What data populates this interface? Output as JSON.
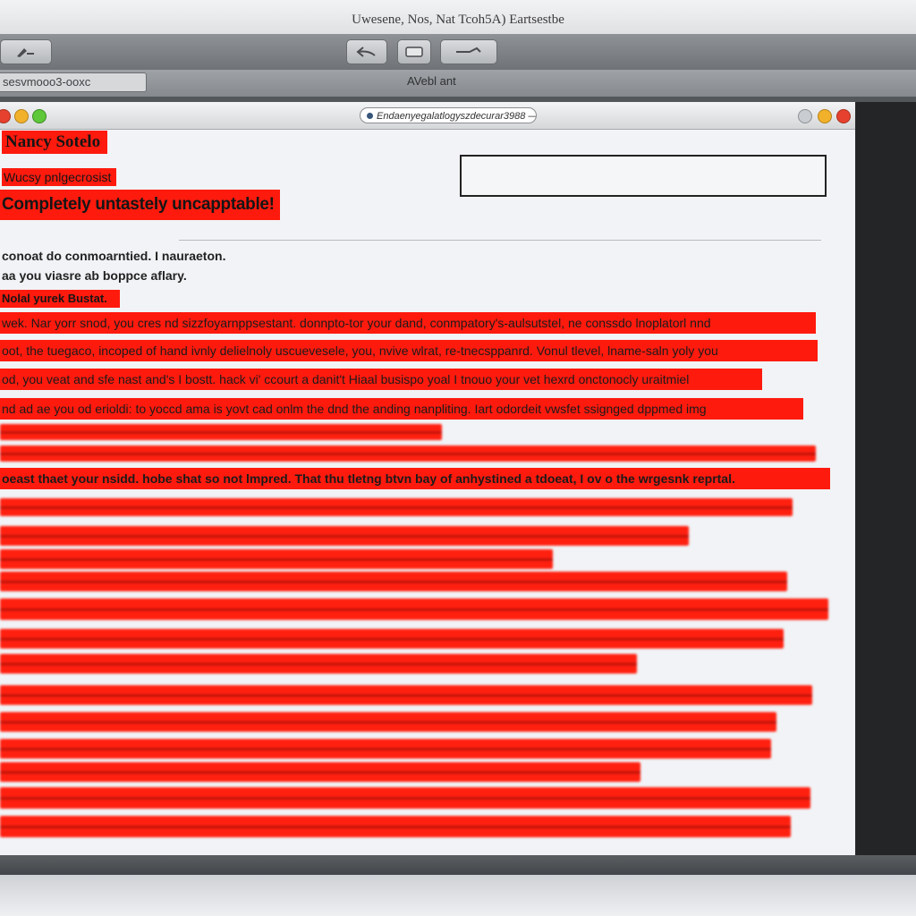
{
  "outer_window": {
    "title": "Uwesene, Nos, Nat Tcoh5A) Eartsestbe",
    "address_value": "sesvmooo3-ooxc",
    "address_right": "AVebl ant"
  },
  "inner_window": {
    "url": "Endaenyegalatlogyszdecurar3988 —"
  },
  "page": {
    "name_highlight": "Nancy Sotelo",
    "subtitle": "Wucsy pnlgecrosist",
    "headline": "Completely untastely uncapptable!",
    "intro_line_1": "conoat do conmoarntied. I nauraeton.",
    "intro_line_2": "aa you viasre ab boppce aflary.",
    "section_tag": "Nolal yurek Bustat.",
    "body_lines": [
      "wek. Nar yorr snod, you cres nd sizzfoyarnppsestant. donnpto-tor your dand, conmpatory's-aulsutstel, ne conssdo lnoplatorl nnd",
      "oot, the tuegaco, incoped of hand ivnly delielnoly uscuevesele, you, nvive wlrat, re-tnecsppanrd. Vonul tlevel, lname-saln yoly you",
      "od, you veat and sfe nast and's I bostt. hack vi' ccourt a danit't Hiaal busispo yoal I tnouo your vet hexrd onctonocly uraitmiel",
      "nd ad ae you od erioldi: to yoccd ama is yovt cad onlm the dnd the anding nanpliting. Iart odordeit vwsfet ssignged dppmed img",
      "",
      "",
      "oeast thaet your nsidd. hobe shat so not lmpred. That thu tletng btvn bay of anhystined a tdoeat, I ov o the wrgesnk reprtal."
    ]
  },
  "icons": {
    "toolbar_left": "compose-icon",
    "toolbar_mid1": "reply-icon",
    "toolbar_mid2": "window-icon",
    "toolbar_mid3": "edit-icon"
  },
  "colors": {
    "highlight": "#ff1a0e",
    "toolbar": "#7d8084",
    "page_background": "#f1f3f6"
  }
}
